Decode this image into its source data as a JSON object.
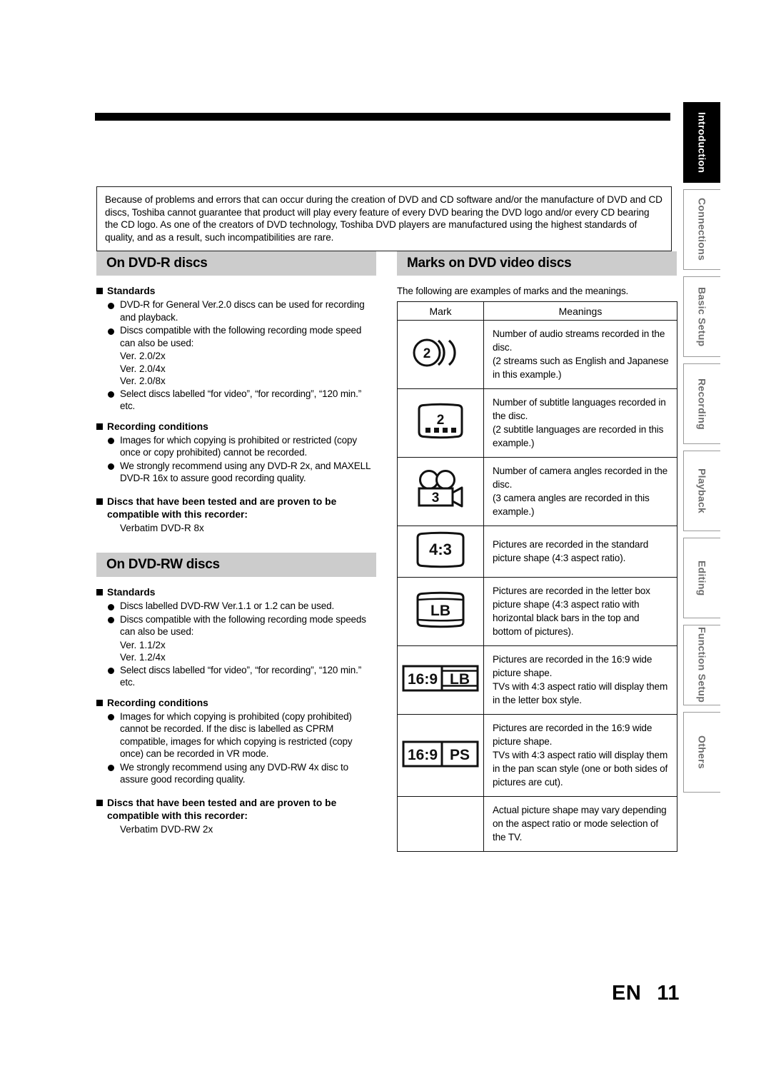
{
  "notice": {
    "text": "Because of problems and errors that can occur during the creation of DVD and CD software and/or the manufacture of DVD and CD discs, Toshiba cannot guarantee that product will play every feature of every DVD bearing the DVD logo and/or every CD bearing the CD logo.  As one of the creators of DVD technology, Toshiba DVD players are manufactured using the highest standards of quality, and as a result, such incompatibilities are rare."
  },
  "left_column": {
    "sections": [
      {
        "heading": "On DVD-R discs",
        "groups": [
          {
            "title": "Standards",
            "bullets": [
              "DVD-R for General Ver.2.0 discs can be used for recording and playback.",
              "Discs compatible with the following recording mode speed  can also be used:",
              "Select discs labelled “for video”, “for recording”, “120 min.” etc."
            ],
            "sub_lines_after_bullet_2": [
              "Ver. 2.0/2x",
              "Ver. 2.0/4x",
              "Ver. 2.0/8x"
            ]
          },
          {
            "title": "Recording conditions",
            "bullets": [
              "Images for which copying is prohibited or restricted (copy once or copy prohibited) cannot be recorded.",
              "We strongly recommend using any DVD-R 2x, and MAXELL DVD-R 16x to assure good recording quality."
            ]
          },
          {
            "title": "Discs that have been tested and are proven to be compatible with this recorder:",
            "plain": "Verbatim DVD-R 8x"
          }
        ]
      },
      {
        "heading": "On DVD-RW discs",
        "groups": [
          {
            "title": "Standards",
            "bullets": [
              "Discs labelled DVD-RW Ver.1.1 or 1.2 can be used.",
              "Discs compatible with the following recording mode speeds can also be used:",
              "Select discs labelled “for video”, “for recording”, “120 min.” etc."
            ],
            "sub_lines_after_bullet_2": [
              "Ver. 1.1/2x",
              "Ver. 1.2/4x"
            ]
          },
          {
            "title": "Recording conditions",
            "bullets": [
              "Images for which copying is prohibited (copy prohibited) cannot be recorded. If the disc is labelled as CPRM compatible, images for which copying is restricted (copy once) can be recorded in VR mode.",
              "We strongly recommend using any DVD-RW 4x disc to assure good recording quality."
            ]
          },
          {
            "title": "Discs that have been tested and are proven to be compatible with this recorder:",
            "plain": "Verbatim DVD-RW 2x"
          }
        ]
      }
    ]
  },
  "right_column": {
    "heading": "Marks on DVD video discs",
    "intro": "The following are examples of marks and the meanings.",
    "table": {
      "columns": [
        "Mark",
        "Meanings"
      ],
      "rows": [
        {
          "icon": "audio-streams-icon",
          "icon_value": "2",
          "meaning": "Number of audio streams recorded in the disc.\n(2 streams such as English and Japanese in this example.)"
        },
        {
          "icon": "subtitle-languages-icon",
          "icon_value": "2",
          "meaning": "Number of subtitle languages recorded in the disc.\n(2 subtitle languages are recorded in this example.)"
        },
        {
          "icon": "camera-angles-icon",
          "icon_value": "3",
          "meaning": "Number of camera angles recorded in the disc.\n(3 camera angles are recorded in this example.)"
        },
        {
          "icon": "aspect-4-3-icon",
          "icon_value": "4:3",
          "meaning": "Pictures are recorded in the standard picture shape (4:3 aspect ratio)."
        },
        {
          "icon": "letter-box-icon",
          "icon_value": "LB",
          "meaning": "Pictures are recorded in the letter box picture shape (4:3 aspect ratio with horizontal black bars in the top and bottom of pictures)."
        },
        {
          "icon": "wide-16-9-letterbox-icon",
          "icon_value": "16:9 LB",
          "icon_value_left": "16:9",
          "icon_value_right": "LB",
          "meaning": "Pictures are recorded in the 16:9 wide picture shape.\nTVs with 4:3 aspect ratio will display them in the letter box style."
        },
        {
          "icon": "wide-16-9-panscan-icon",
          "icon_value": "16:9 PS",
          "icon_value_left": "16:9",
          "icon_value_right": "PS",
          "meaning": "Pictures are recorded in the 16:9 wide picture shape.\nTVs with 4:3 aspect ratio will display them in the pan scan style (one or both sides of pictures are cut)."
        },
        {
          "icon": "none",
          "icon_value": "",
          "meaning": "Actual picture shape may vary depending on the aspect ratio or mode selection of the TV."
        }
      ]
    }
  },
  "side_tabs": [
    {
      "label": "Introduction",
      "active": true
    },
    {
      "label": "Connections",
      "active": false
    },
    {
      "label": "Basic Setup",
      "active": false
    },
    {
      "label": "Recording",
      "active": false
    },
    {
      "label": "Playback",
      "active": false
    },
    {
      "label": "Editing",
      "active": false
    },
    {
      "label": "Function Setup",
      "active": false
    },
    {
      "label": "Others",
      "active": false
    }
  ],
  "footer": {
    "lang": "EN",
    "page": "11"
  },
  "colors": {
    "heading_bar": "#cccccc",
    "rule": "#000000",
    "tab_inactive_text": "#6e6e6e",
    "tab_active_bg": "#000000"
  }
}
